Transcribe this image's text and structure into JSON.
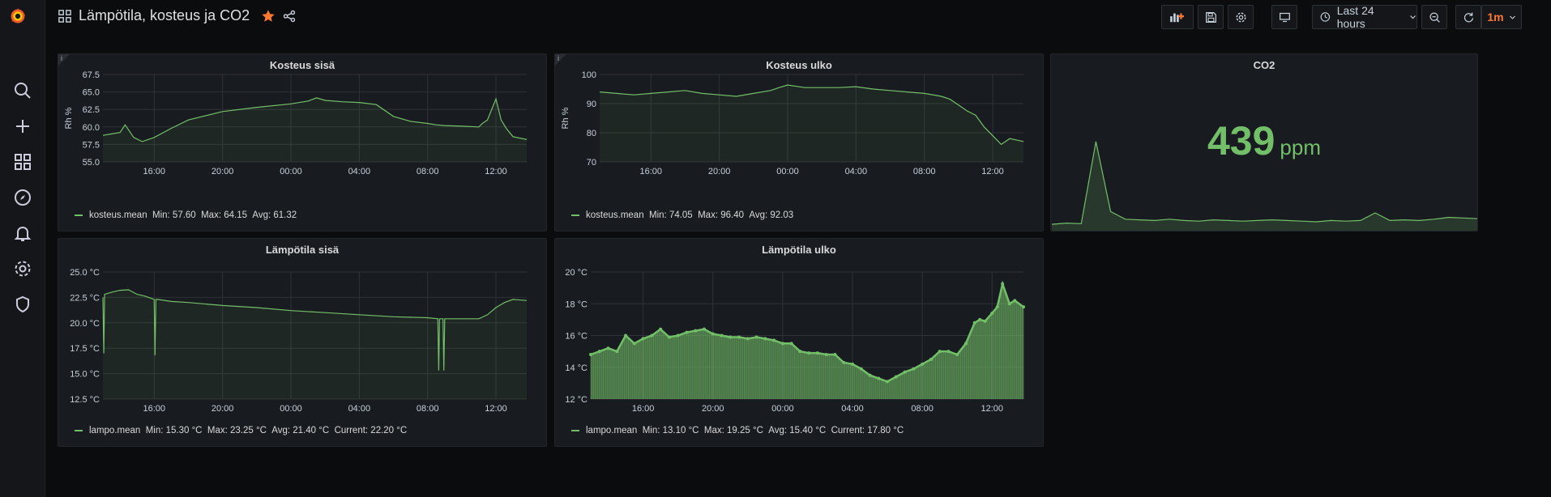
{
  "dashboard": {
    "title": "Lämpötila, kosteus ja CO2"
  },
  "toolbar": {
    "time_range": "Last 24 hours",
    "refresh": "1m"
  },
  "colors": {
    "series": "#73bf69",
    "accent": "#ff7830",
    "background": "#0b0c0e",
    "panel": "#181b1f"
  },
  "sidebar": {
    "icons": [
      "search-icon",
      "plus-icon",
      "dashboards-icon",
      "explore-icon",
      "alerting-icon",
      "configuration-icon",
      "shield-icon"
    ]
  },
  "panels": {
    "kosteus_sisa": {
      "title": "Kosteus sisä",
      "info": "i",
      "legend": {
        "name": "kosteus.mean",
        "min": "Min: 57.60",
        "max": "Max: 64.15",
        "avg": "Avg: 61.32"
      }
    },
    "kosteus_ulko": {
      "title": "Kosteus ulko",
      "info": "i",
      "legend": {
        "name": "kosteus.mean",
        "min": "Min: 74.05",
        "max": "Max: 96.40",
        "avg": "Avg: 92.03"
      }
    },
    "co2": {
      "title": "CO2",
      "value": "439",
      "unit": "ppm"
    },
    "lampo_sisa": {
      "title": "Lämpötila sisä",
      "legend": {
        "name": "lampo.mean",
        "min": "Min: 15.30 °C",
        "max": "Max: 23.25 °C",
        "avg": "Avg: 21.40 °C",
        "current": "Current: 22.20 °C"
      }
    },
    "lampo_ulko": {
      "title": "Lämpötila ulko",
      "legend": {
        "name": "lampo.mean",
        "min": "Min: 13.10 °C",
        "max": "Max: 19.25 °C",
        "avg": "Avg: 15.40 °C",
        "current": "Current: 17.80 °C"
      }
    }
  },
  "chart_data": [
    {
      "id": "kosteus_sisa",
      "type": "line",
      "title": "Kosteus sisä",
      "ylabel": "Rh %",
      "ylim": [
        55,
        67.5
      ],
      "yticks": [
        "55.0",
        "57.5",
        "60.0",
        "62.5",
        "65.0",
        "67.5"
      ],
      "xticks": [
        "16:00",
        "20:00",
        "00:00",
        "04:00",
        "08:00",
        "12:00"
      ],
      "xlim": [
        13.0,
        37.8
      ],
      "x": [
        13.0,
        13.5,
        14.0,
        14.3,
        14.8,
        15.3,
        16.0,
        17.0,
        18.0,
        20.0,
        22.0,
        24.0,
        25.0,
        25.5,
        26.0,
        27.0,
        28.0,
        29.0,
        30.0,
        31.0,
        32.0,
        32.5,
        33.0,
        34.0,
        35.0,
        35.2,
        35.5,
        35.8,
        36.0,
        36.3,
        36.6,
        37.0,
        37.8
      ],
      "series": [
        {
          "name": "kosteus.mean",
          "values": [
            58.8,
            59.0,
            59.2,
            60.3,
            58.5,
            57.9,
            58.5,
            59.8,
            61.0,
            62.2,
            62.8,
            63.3,
            63.7,
            64.15,
            63.8,
            63.6,
            63.5,
            63.2,
            61.5,
            60.8,
            60.5,
            60.3,
            60.2,
            60.1,
            60.0,
            60.5,
            61.0,
            62.8,
            64.0,
            61.0,
            59.8,
            58.6,
            58.2
          ]
        }
      ]
    },
    {
      "id": "kosteus_ulko",
      "type": "line",
      "title": "Kosteus ulko",
      "ylabel": "Rh %",
      "ylim": [
        70,
        100
      ],
      "yticks": [
        "70",
        "80",
        "90",
        "100"
      ],
      "xticks": [
        "16:00",
        "20:00",
        "00:00",
        "04:00",
        "08:00",
        "12:00"
      ],
      "xlim": [
        13.0,
        37.8
      ],
      "x": [
        13.0,
        14.0,
        15.0,
        16.0,
        17.0,
        18.0,
        19.0,
        20.0,
        21.0,
        22.0,
        23.0,
        23.5,
        24.0,
        25.0,
        26.0,
        27.0,
        28.0,
        29.0,
        30.0,
        31.0,
        32.0,
        33.0,
        33.5,
        34.0,
        34.5,
        35.0,
        35.5,
        36.0,
        36.5,
        37.0,
        37.8
      ],
      "series": [
        {
          "name": "kosteus.mean",
          "values": [
            94.0,
            93.5,
            93.0,
            93.5,
            94.0,
            94.5,
            93.5,
            93.0,
            92.5,
            93.5,
            94.5,
            95.5,
            96.4,
            95.5,
            95.5,
            95.5,
            95.8,
            95.0,
            94.5,
            94.0,
            93.5,
            92.5,
            91.5,
            89.5,
            87.5,
            86.0,
            82.0,
            79.0,
            76.0,
            78.0,
            77.0
          ]
        }
      ]
    },
    {
      "id": "co2",
      "type": "area",
      "title": "CO2",
      "sparkline": true,
      "values": [
        430,
        432,
        431,
        560,
        450,
        438,
        437,
        436,
        438,
        436,
        435,
        437,
        436,
        435,
        436,
        437,
        436,
        435,
        434,
        436,
        435,
        436,
        448,
        436,
        437,
        436,
        438,
        441,
        440,
        439
      ]
    },
    {
      "id": "lampo_sisa",
      "type": "line",
      "title": "Lämpötila sisä",
      "ylim": [
        12.5,
        25.0
      ],
      "yticks": [
        "12.5 °C",
        "15.0 °C",
        "17.5 °C",
        "20.0 °C",
        "22.5 °C",
        "25.0 °C"
      ],
      "xticks": [
        "16:00",
        "20:00",
        "00:00",
        "04:00",
        "08:00",
        "12:00"
      ],
      "xlim": [
        13.0,
        37.8
      ],
      "x": [
        13.0,
        13.05,
        13.1,
        13.5,
        14.0,
        14.5,
        15.0,
        15.5,
        16.0,
        16.05,
        16.1,
        16.2,
        17.0,
        18.0,
        20.0,
        22.0,
        24.0,
        26.0,
        28.0,
        30.0,
        32.0,
        32.6,
        32.65,
        32.7,
        32.9,
        32.95,
        33.0,
        34.0,
        35.0,
        35.5,
        36.0,
        36.5,
        37.0,
        37.8
      ],
      "series": [
        {
          "name": "lampo.mean",
          "values": [
            22.5,
            17.0,
            22.8,
            23.0,
            23.2,
            23.25,
            22.8,
            22.6,
            22.3,
            16.8,
            22.3,
            22.3,
            22.1,
            22.0,
            21.7,
            21.5,
            21.2,
            21.0,
            20.8,
            20.6,
            20.5,
            20.4,
            15.3,
            20.4,
            20.4,
            15.3,
            20.4,
            20.4,
            20.4,
            20.8,
            21.5,
            22.0,
            22.3,
            22.2
          ]
        }
      ]
    },
    {
      "id": "lampo_ulko",
      "type": "area",
      "title": "Lämpötila ulko",
      "ylim": [
        12,
        20
      ],
      "yticks": [
        "12 °C",
        "14 °C",
        "16 °C",
        "18 °C",
        "20 °C"
      ],
      "xticks": [
        "16:00",
        "20:00",
        "00:00",
        "04:00",
        "08:00",
        "12:00"
      ],
      "xlim": [
        13.0,
        37.8
      ],
      "x": [
        13.0,
        13.5,
        14.0,
        14.5,
        15.0,
        15.5,
        16.0,
        16.5,
        17.0,
        17.5,
        18.0,
        18.5,
        19.0,
        19.5,
        20.0,
        20.5,
        21.0,
        21.5,
        22.0,
        22.5,
        23.0,
        23.5,
        24.0,
        24.5,
        25.0,
        25.5,
        26.0,
        26.5,
        27.0,
        27.5,
        28.0,
        28.5,
        29.0,
        29.5,
        30.0,
        30.5,
        31.0,
        31.5,
        32.0,
        32.5,
        33.0,
        33.5,
        34.0,
        34.5,
        35.0,
        35.3,
        35.6,
        36.0,
        36.3,
        36.6,
        37.0,
        37.3,
        37.8
      ],
      "series": [
        {
          "name": "lampo.mean",
          "values": [
            14.8,
            15.0,
            15.2,
            15.0,
            16.0,
            15.5,
            15.8,
            16.0,
            16.4,
            15.9,
            16.0,
            16.2,
            16.3,
            16.4,
            16.1,
            16.0,
            15.9,
            15.9,
            15.8,
            15.9,
            15.8,
            15.7,
            15.5,
            15.5,
            15.0,
            14.9,
            14.9,
            14.8,
            14.8,
            14.3,
            14.2,
            13.9,
            13.5,
            13.3,
            13.1,
            13.4,
            13.7,
            13.9,
            14.2,
            14.5,
            15.0,
            15.0,
            14.8,
            15.5,
            16.8,
            17.0,
            16.9,
            17.4,
            17.8,
            19.25,
            18.0,
            18.2,
            17.8
          ]
        }
      ]
    }
  ]
}
